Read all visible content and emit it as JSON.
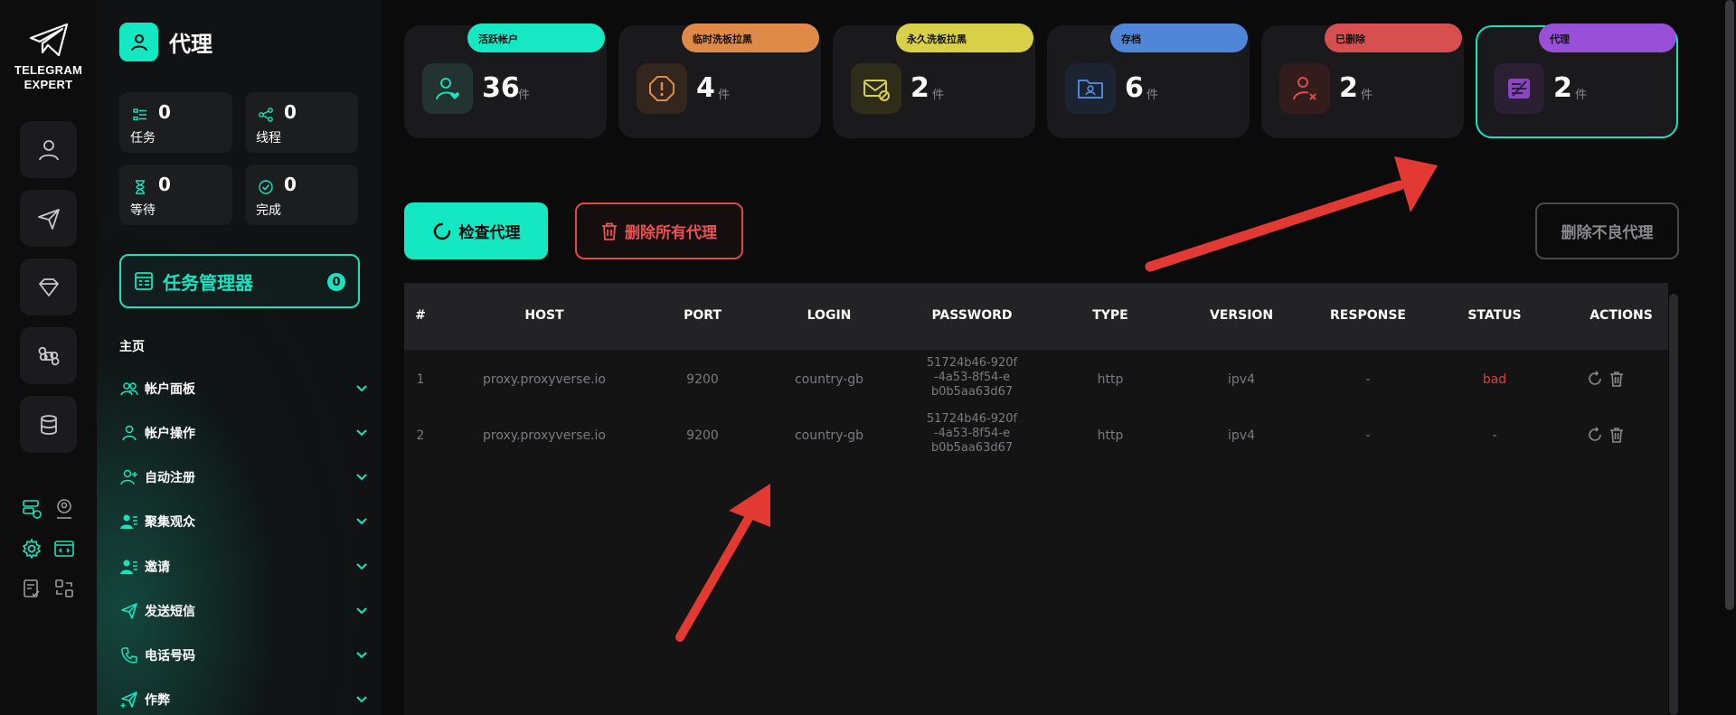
{
  "brand": {
    "line1": "TELEGRAM",
    "line2": "EXPERT"
  },
  "sidebar": {
    "title": "代理",
    "stats": [
      {
        "value": "0",
        "label": "任务",
        "icon": "tasks-icon"
      },
      {
        "value": "0",
        "label": "线程",
        "icon": "threads-icon"
      },
      {
        "value": "0",
        "label": "等待",
        "icon": "hourglass-icon"
      },
      {
        "value": "0",
        "label": "完成",
        "icon": "check-circle-icon"
      }
    ],
    "task_manager": {
      "label": "任务管理器",
      "count": "0"
    },
    "home_label": "主页",
    "nav": [
      {
        "label": "帐户面板"
      },
      {
        "label": "帐户操作"
      },
      {
        "label": "自动注册"
      },
      {
        "label": "聚集观众"
      },
      {
        "label": "邀请"
      },
      {
        "label": "发送短信"
      },
      {
        "label": "电话号码"
      },
      {
        "label": "作弊"
      }
    ]
  },
  "cards": [
    {
      "tag": "活跃帐户",
      "value": "36",
      "unit": "件",
      "color": "#16e8c4"
    },
    {
      "tag": "临时洗板拉黑",
      "value": "4",
      "unit": "件",
      "color": "#e08a4a"
    },
    {
      "tag": "永久洗板拉黑",
      "value": "2",
      "unit": "件",
      "color": "#d8d048"
    },
    {
      "tag": "存档",
      "value": "6",
      "unit": "件",
      "color": "#4f86d8"
    },
    {
      "tag": "已删除",
      "value": "2",
      "unit": "件",
      "color": "#d84f4f"
    },
    {
      "tag": "代理",
      "value": "2",
      "unit": "件",
      "color": "#9a4fd8"
    }
  ],
  "buttons": {
    "check": "检查代理",
    "delete_all": "删除所有代理",
    "delete_bad": "删除不良代理"
  },
  "table": {
    "headers": [
      "#",
      "HOST",
      "PORT",
      "LOGIN",
      "PASSWORD",
      "TYPE",
      "VERSION",
      "RESPONSE",
      "STATUS",
      "ACTIONS"
    ],
    "rows": [
      {
        "n": "1",
        "host": "proxy.proxyverse.io",
        "port": "9200",
        "login": "country-gb",
        "pw1": "51724b46-920f",
        "pw2": "-4a53-8f54-e",
        "pw3": "b0b5aa63d67",
        "type": "http",
        "version": "ipv4",
        "response": "-",
        "status": "bad"
      },
      {
        "n": "2",
        "host": "proxy.proxyverse.io",
        "port": "9200",
        "login": "country-gb",
        "pw1": "51724b46-920f",
        "pw2": "-4a53-8f54-e",
        "pw3": "b0b5aa63d67",
        "type": "http",
        "version": "ipv4",
        "response": "-",
        "status": "-"
      }
    ]
  }
}
